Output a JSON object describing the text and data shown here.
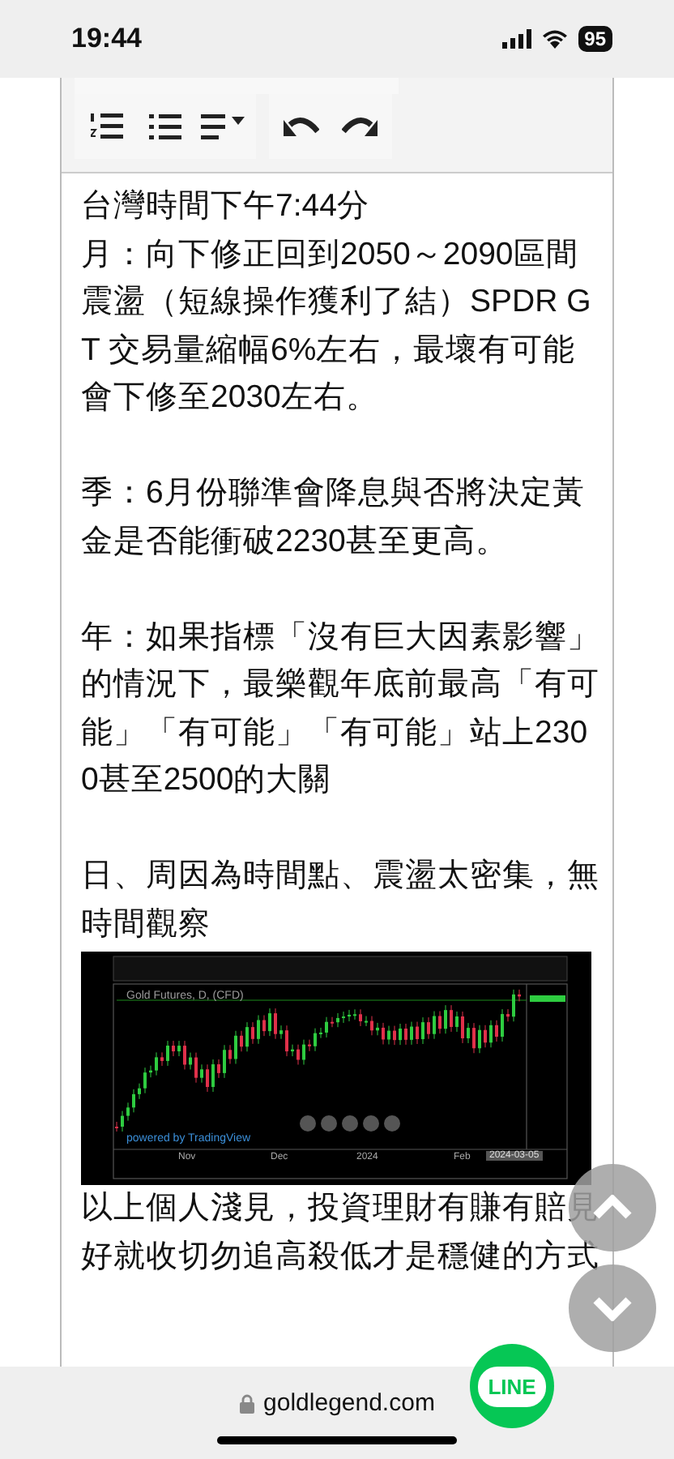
{
  "status_bar": {
    "time": "19:44",
    "battery": "95"
  },
  "toolbar": {
    "groups": [
      {
        "buttons": [
          {
            "kind": "ordered-list"
          },
          {
            "kind": "bullet-list"
          },
          {
            "kind": "align"
          }
        ]
      },
      {
        "buttons": [
          {
            "kind": "undo"
          },
          {
            "kind": "redo"
          }
        ]
      }
    ]
  },
  "blocks": [
    {
      "kind": "text",
      "lines": [
        "台灣時間下午7:44分",
        "月：向下修正回到2050～2090區間震盪（短線操作獲利了結）SPDR GT 交易量縮幅6%左右，最壞有可能會下修至2030左右。"
      ]
    },
    {
      "kind": "text",
      "lines": [
        "季：6月份聯準會降息與否將決定黃金是否能衝破2230甚至更高。"
      ]
    },
    {
      "kind": "text",
      "lines": [
        "年：如果指標「沒有巨大因素影響」的情況下，最樂觀年底前最高「有可能」「有可能」「有可能」站上2300甚至2500的大關"
      ]
    },
    {
      "kind": "text",
      "lines": [
        "日、周因為時間點、震盪太密集，無時間觀察"
      ]
    },
    {
      "kind": "chart-image",
      "title": "Gold Futures, D, (CFD)",
      "credit": "powered by TradingView",
      "x_labels": [
        "Nov",
        "Dec",
        "2024",
        "Feb"
      ],
      "date_label": "2024-03-05"
    },
    {
      "kind": "text",
      "lines": [
        "以上個人淺見，投資理財有賺有賠見好就收切勿追高殺低才是穩健的方式"
      ]
    }
  ],
  "floating": {
    "line_label": "LINE"
  },
  "address_bar": {
    "url": "goldlegend.com"
  }
}
